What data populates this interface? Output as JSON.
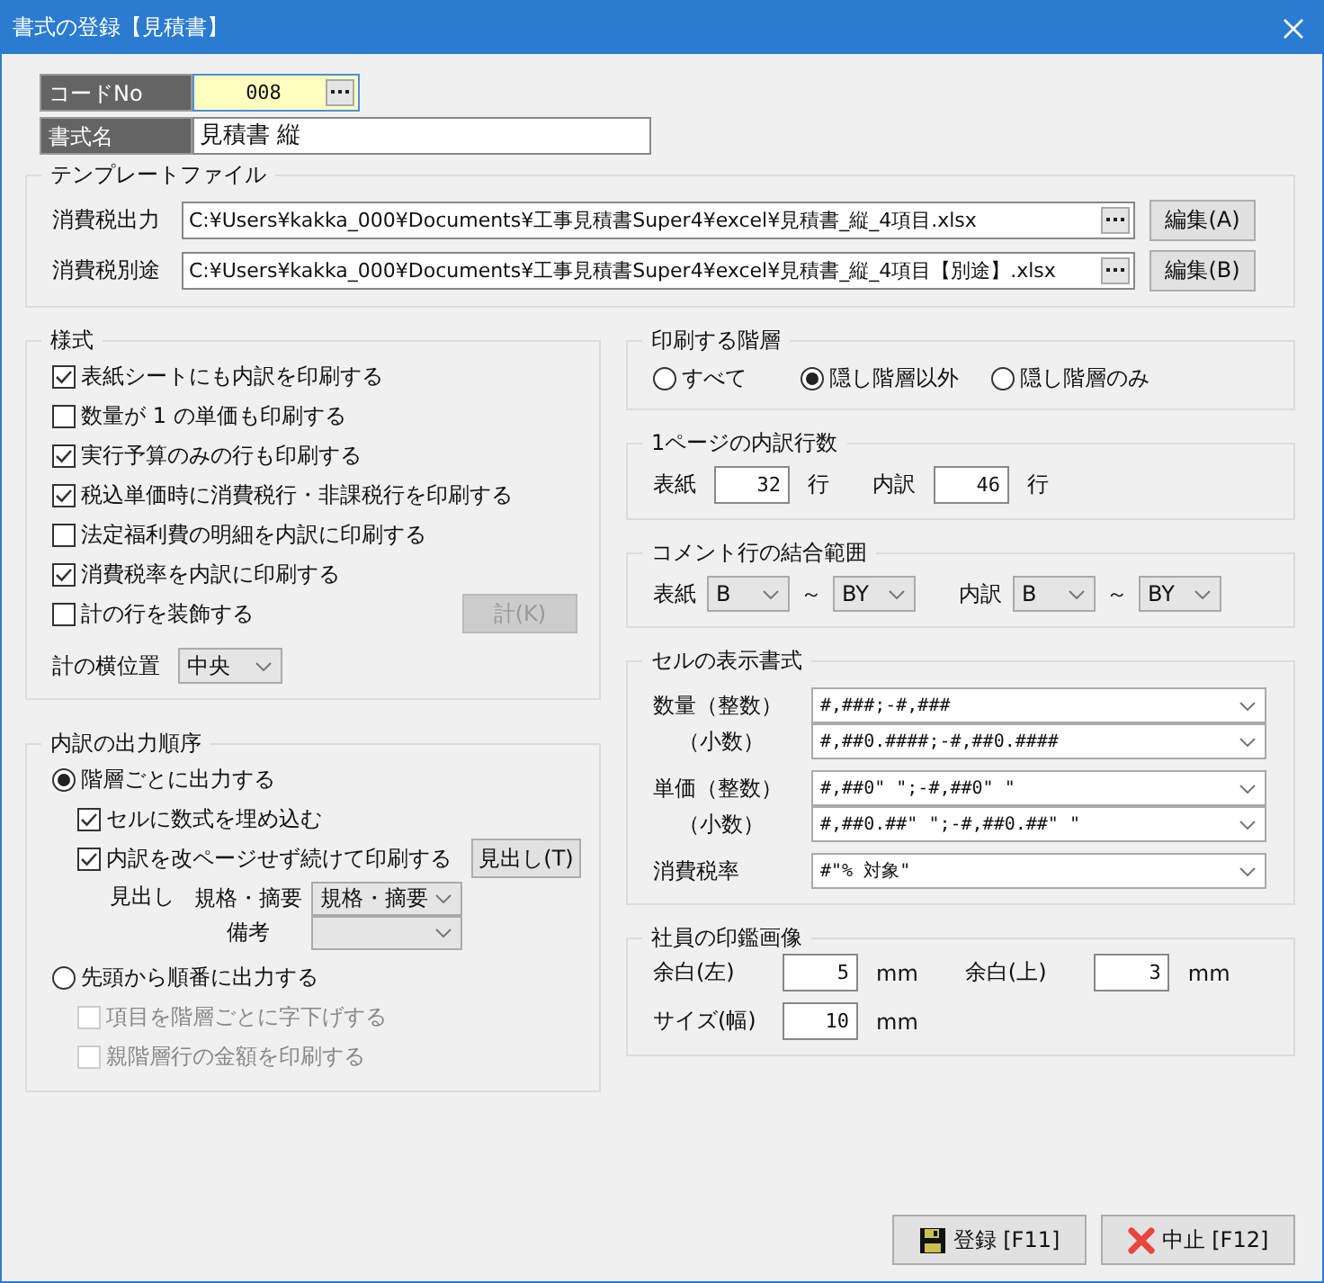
{
  "window": {
    "title": "書式の登録【見積書】"
  },
  "code": {
    "label": "コードNo",
    "value": "008"
  },
  "name": {
    "label": "書式名",
    "value": "見積書  縦"
  },
  "template": {
    "title": "テンプレートファイル",
    "rows": [
      {
        "label": "消費税出力",
        "path": "C:¥Users¥kakka_000¥Documents¥工事見積書Super4¥excel¥見積書_縦_4項目.xlsx",
        "button": "編集(A)"
      },
      {
        "label": "消費税別途",
        "path": "C:¥Users¥kakka_000¥Documents¥工事見積書Super4¥excel¥見積書_縦_4項目【別途】.xlsx",
        "button": "編集(B)"
      }
    ]
  },
  "style_group": {
    "title": "様式",
    "options": [
      {
        "label": "表紙シートにも内訳を印刷する",
        "checked": true
      },
      {
        "label": "数量が 1 の単価も印刷する",
        "checked": false
      },
      {
        "label": "実行予算のみの行も印刷する",
        "checked": true
      },
      {
        "label": "税込単価時に消費税行・非課税行を印刷する",
        "checked": true
      },
      {
        "label": "法定福利費の明細を内訳に印刷する",
        "checked": false
      },
      {
        "label": "消費税率を内訳に印刷する",
        "checked": true
      },
      {
        "label": "計の行を装飾する",
        "checked": false
      }
    ],
    "total_button": {
      "label": "計(K)",
      "disabled": true
    },
    "position": {
      "label": "計の横位置",
      "value": "中央"
    }
  },
  "order_group": {
    "title": "内訳の出力順序",
    "choices": [
      {
        "label": "階層ごとに出力する",
        "selected": true,
        "options": [
          {
            "label": "セルに数式を埋め込む",
            "checked": true,
            "disabled": false
          },
          {
            "label": "内訳を改ページせず続けて印刷する",
            "checked": true,
            "disabled": false
          }
        ],
        "heading_button": "見出し(T)",
        "heading_label": "見出し",
        "headings": [
          {
            "label": "規格・摘要",
            "value": "規格・摘要"
          },
          {
            "label": "備考"
          }
        ]
      },
      {
        "label": "先頭から順番に出力する",
        "selected": false,
        "options": [
          {
            "label": "項目を階層ごとに字下げする",
            "checked": false,
            "disabled": true
          },
          {
            "label": "親階層行の金額を印刷する",
            "checked": false,
            "disabled": true
          }
        ]
      }
    ]
  },
  "print_level": {
    "title": "印刷する階層",
    "options": [
      {
        "label": "すべて",
        "selected": false
      },
      {
        "label": "隠し階層以外",
        "selected": true
      },
      {
        "label": "隠し階層のみ",
        "selected": false
      }
    ]
  },
  "rows_per_page": {
    "title": "1ページの内訳行数",
    "fields": [
      {
        "label": "表紙",
        "value": "32",
        "unit": "行"
      },
      {
        "label": "内訳",
        "value": "46",
        "unit": "行"
      }
    ]
  },
  "comment_range": {
    "title": "コメント行の結合範囲",
    "ranges": [
      {
        "label": "表紙",
        "from": "B",
        "separator": "～",
        "to": "BY"
      },
      {
        "label": "内訳",
        "from": "B",
        "separator": "～",
        "to": "BY"
      }
    ]
  },
  "cell_format": {
    "title": "セルの表示書式",
    "groups": [
      {
        "rows": [
          {
            "label": "数量（整数）",
            "value": "#,###;-#,###"
          },
          {
            "label": "（小数）",
            "value": "#,##0.####;-#,##0.####"
          }
        ]
      },
      {
        "rows": [
          {
            "label": "単価（整数）",
            "value": "#,##0\" \";-#,##0\" \""
          },
          {
            "label": "（小数）",
            "value": "#,##0.##\" \";-#,##0.##\" \""
          }
        ]
      },
      {
        "rows": [
          {
            "label": "消費税率",
            "value": "#\"% 対象\""
          }
        ]
      }
    ]
  },
  "stamp": {
    "title": "社員の印鑑画像",
    "fields": [
      {
        "label": "余白(左)",
        "value": "5",
        "unit": "mm"
      },
      {
        "label": "余白(上)",
        "value": "3",
        "unit": "mm"
      },
      {
        "label": "サイズ(幅)",
        "value": "10",
        "unit": "mm"
      }
    ]
  },
  "buttons": [
    {
      "label": "登録 [F11]",
      "kind": "save"
    },
    {
      "label": "中止 [F12]",
      "kind": "cancel"
    }
  ]
}
